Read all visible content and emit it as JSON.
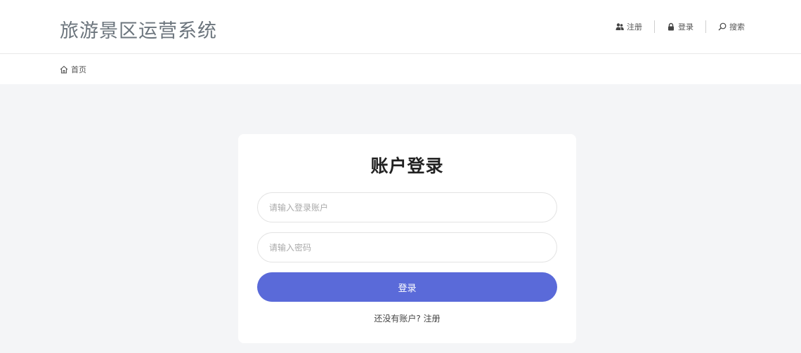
{
  "header": {
    "brand": "旅游景区运营系统",
    "nav": {
      "register": "注册",
      "login": "登录",
      "search": "搜索"
    }
  },
  "breadcrumb": {
    "home": "首页"
  },
  "login_card": {
    "title": "账户登录",
    "account_placeholder": "请输入登录账户",
    "password_placeholder": "请输入密码",
    "submit_label": "登录",
    "no_account_text": "还没有账户?",
    "register_link": "注册"
  },
  "colors": {
    "primary": "#5a6ad9",
    "background": "#f4f5f7",
    "brand_text": "#6c757d"
  },
  "icons": {
    "register": "users-icon",
    "login": "lock-icon",
    "search": "search-icon",
    "home": "home-icon"
  }
}
